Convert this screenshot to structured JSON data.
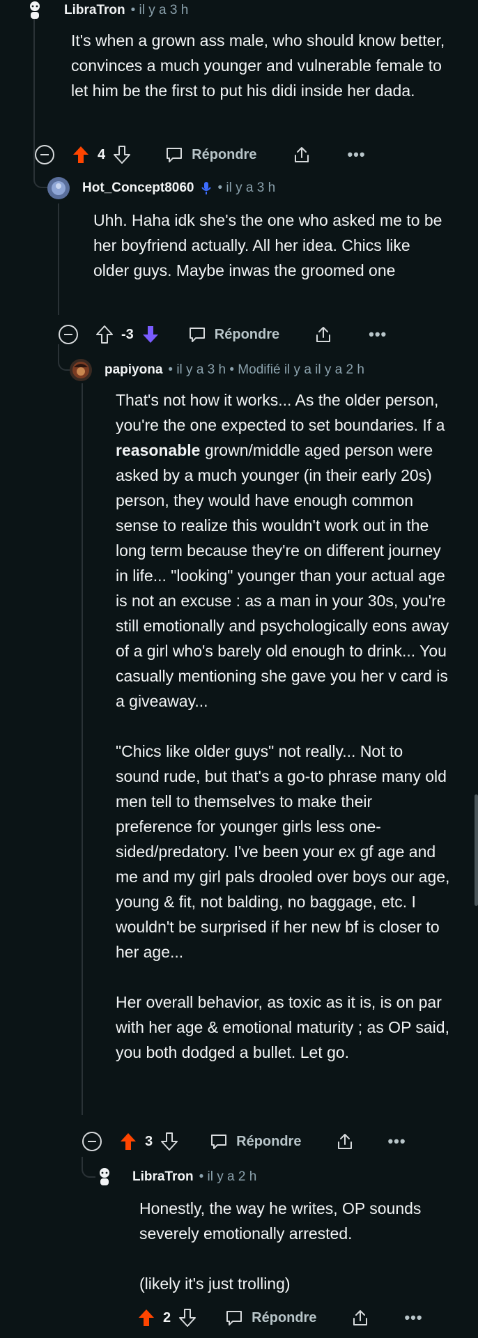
{
  "colors": {
    "background": "#0b1416",
    "upvote_active": "#ff4500",
    "downvote_active": "#7a5cff",
    "meta_text": "#8ba2ad",
    "thread_line": "#2a3236"
  },
  "comments": [
    {
      "author": "LibraTron",
      "meta": "• il y a 3 h",
      "avatar_icon": "snoo-avatar-icon",
      "body": [
        "It's when a grown ass male, who should know better, convinces a much younger and vulnerable female to let him be the first to put his didi inside her dada."
      ],
      "score": "4",
      "vote_state": "upvoted",
      "reply_label": "Répondre",
      "more_label": "•••"
    },
    {
      "author": "Hot_Concept8060",
      "meta": "• il y a 3 h",
      "avatar_icon": "user-avatar-icon",
      "badge_icon": "microphone-icon",
      "body": [
        "Uhh. Haha idk she's the one who asked me to be her boyfriend actually. All her idea. Chics like older guys. Maybe inwas the groomed one"
      ],
      "score": "-3",
      "vote_state": "downvoted",
      "reply_label": "Répondre",
      "more_label": "•••"
    },
    {
      "author": "papiyona",
      "meta": "• il y a 3 h • Modifié il y a il y a 2 h",
      "avatar_icon": "user-avatar-icon",
      "body_p1_before": "That's not how it works... As the older person, you're the one expected to set boundaries. If a ",
      "body_p1_bold": "reasonable",
      "body_p1_after": " grown/middle aged person were asked by a much younger (in their early 20s) person, they would have enough common sense to realize this wouldn't work out in the long term because they're on different journey in life... \"looking\" younger than your actual age is not an excuse : as a man in your 30s, you're still emotionally and psychologically eons away of a girl who's barely old enough to drink... You casually mentioning she gave you her v card is a giveaway...",
      "body_p2": "\"Chics like older guys\" not really... Not to sound rude, but that's a go-to phrase many old men tell to themselves to make their preference for younger girls less one-sided/predatory. I've been your ex gf age and me and my girl pals drooled over boys our age, young & fit, not balding, no baggage, etc. I wouldn't be surprised if her new bf is closer to her age...",
      "body_p3": "Her overall behavior, as toxic as it is, is on par with her age & emotional maturity ; as OP said, you both dodged a bullet. Let go.",
      "score": "3",
      "vote_state": "upvoted",
      "reply_label": "Répondre",
      "more_label": "•••"
    },
    {
      "author": "LibraTron",
      "meta": "• il y a 2 h",
      "avatar_icon": "snoo-avatar-icon",
      "body": [
        "Honestly, the way he writes, OP sounds severely emotionally arrested.",
        "(likely it's just trolling)"
      ],
      "score": "2",
      "vote_state": "upvoted",
      "reply_label": "Répondre",
      "more_label": "•••"
    }
  ]
}
